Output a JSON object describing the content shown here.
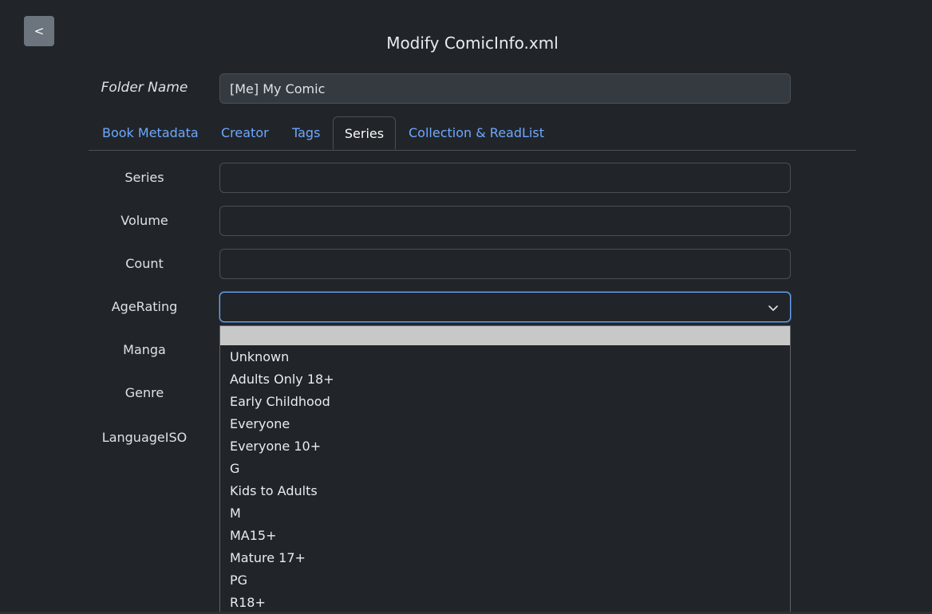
{
  "header": {
    "back_label": "<",
    "title": "Modify ComicInfo.xml"
  },
  "folder": {
    "label": "Folder Name",
    "value": "[Me] My Comic"
  },
  "tabs": [
    {
      "label": "Book Metadata",
      "active": false
    },
    {
      "label": "Creator",
      "active": false
    },
    {
      "label": "Tags",
      "active": false
    },
    {
      "label": "Series",
      "active": true
    },
    {
      "label": "Collection & ReadList",
      "active": false
    }
  ],
  "fields": {
    "series": {
      "label": "Series",
      "value": ""
    },
    "volume": {
      "label": "Volume",
      "value": ""
    },
    "count": {
      "label": "Count",
      "value": ""
    },
    "age_rating": {
      "label": "AgeRating",
      "value": ""
    },
    "manga": {
      "label": "Manga"
    },
    "genre": {
      "label": "Genre"
    },
    "language": {
      "label": "LanguageISO"
    }
  },
  "age_rating_options": [
    "",
    "Unknown",
    "Adults Only 18+",
    "Early Childhood",
    "Everyone",
    "Everyone 10+",
    "G",
    "Kids to Adults",
    "M",
    "MA15+",
    "Mature 17+",
    "PG",
    "R18+"
  ],
  "colors": {
    "background": "#212529",
    "link": "#6ea8fe",
    "highlight": "#c8c8c8"
  }
}
